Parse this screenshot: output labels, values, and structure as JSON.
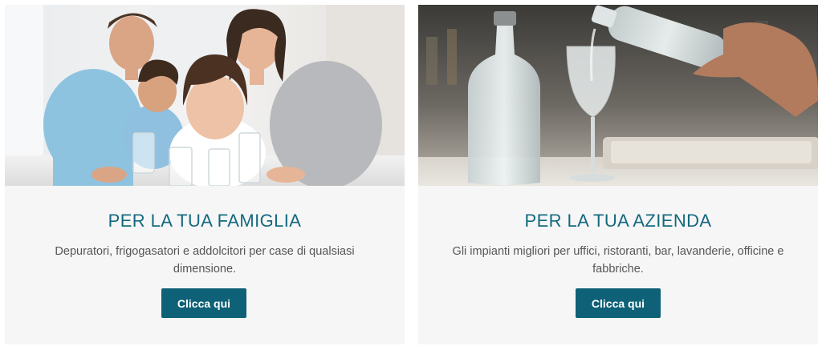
{
  "cards": [
    {
      "title": "PER LA TUA FAMIGLIA",
      "description": "Depuratori, frigogasatori e addolcitori per case di qualsiasi dimensione.",
      "button_label": "Clicca qui",
      "image_icon": "family-drinking-water-photo"
    },
    {
      "title": "PER LA TUA AZIENDA",
      "description": "Gli impianti migliori per uffici, ristoranti, bar, lavanderie, officine e fabbriche.",
      "button_label": "Clicca qui",
      "image_icon": "water-bottle-pouring-photo"
    }
  ],
  "colors": {
    "title": "#14697f",
    "button": "#0e6176",
    "card_background": "#f6f6f6",
    "text": "#555555"
  }
}
